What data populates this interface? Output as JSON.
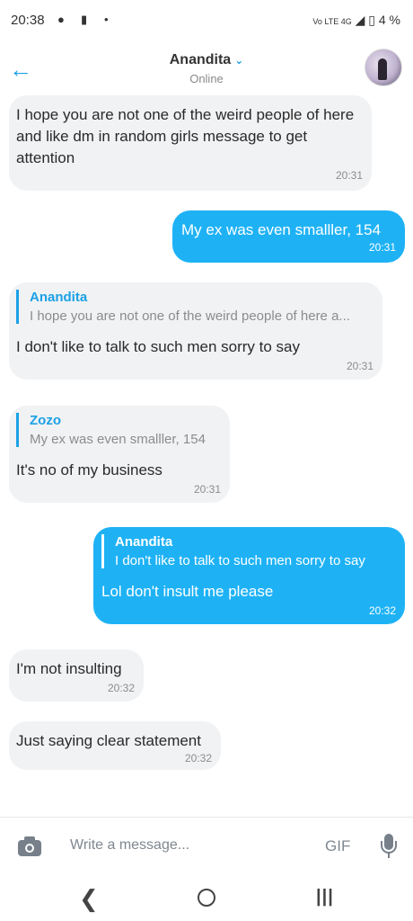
{
  "status_bar": {
    "time": "20:38",
    "network": "Vo LTE 4G",
    "battery": "4 %"
  },
  "header": {
    "contact_name": "Anandita",
    "presence": "Online"
  },
  "messages": [
    {
      "direction": "in",
      "text": "I hope you are not one of the weird people of here and like dm in random girls message to get attention",
      "time": "20:31"
    },
    {
      "direction": "out",
      "text": "My ex was even smalller, 154",
      "time": "20:31"
    },
    {
      "direction": "in",
      "reply_to": {
        "name": "Anandita",
        "text": "I hope you are not one of the weird people of here a..."
      },
      "text": "I don't like to talk to such men sorry to say",
      "time": "20:31"
    },
    {
      "direction": "in",
      "reply_to": {
        "name": "Zozo",
        "text": "My ex was even smalller, 154"
      },
      "text": "It's no of my business",
      "time": "20:31"
    },
    {
      "direction": "out",
      "reply_to": {
        "name": "Anandita",
        "text": "I don't like to talk to such men sorry to say"
      },
      "text": "Lol don't insult me please",
      "time": "20:32"
    },
    {
      "direction": "in",
      "text": "I'm not insulting",
      "time": "20:32"
    },
    {
      "direction": "in",
      "text": "Just saying clear statement",
      "time": "20:32"
    }
  ],
  "composer": {
    "placeholder": "Write a message...",
    "gif_label": "GIF"
  },
  "colors": {
    "accent": "#1aa1e6",
    "outgoing_bubble": "#1eb2f5",
    "incoming_bubble": "#f1f2f4"
  }
}
